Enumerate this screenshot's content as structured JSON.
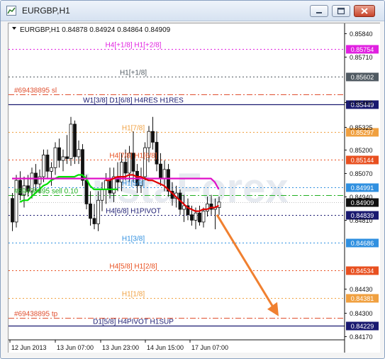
{
  "window": {
    "title": "EURGBP,H1"
  },
  "chart_header": "EURGBP,H1  0.84878 0.84924 0.84864 0.84909",
  "watermark": "InstaForex",
  "chart_data": {
    "type": "candlestick",
    "symbol": "EURGBP",
    "timeframe": "H1",
    "ohlc_header": {
      "open": 0.84878,
      "high": 0.84924,
      "low": 0.84864,
      "close": 0.84909
    },
    "ylim": [
      0.8415,
      0.8588
    ],
    "y_ticks": [
      0.8584,
      0.8571,
      0.8546,
      0.85325,
      0.852,
      0.8507,
      0.8494,
      0.8481,
      0.8443,
      0.843,
      0.8417
    ],
    "y_tick_labels": [
      "0.85840",
      "0.85710",
      "0.85460",
      "0.85325",
      "0.85200",
      "0.85070",
      "0.84940",
      "0.84810",
      "0.84430",
      "0.84300",
      "0.84170"
    ],
    "x_tick_labels": [
      "12 Jun 2013",
      "13 Jun 07:00",
      "13 Jun 23:00",
      "14 Jun 15:00",
      "17 Jun 07:00"
    ],
    "levels": [
      {
        "label": "H4[+1/8] H1[+2/8]",
        "price": 0.85754,
        "price_label": "0.85754",
        "color": "#e020e0",
        "style": "dotted"
      },
      {
        "label": "H1[+1/8]",
        "price": 0.85602,
        "price_label": "0.85602",
        "color": "#505a62",
        "style": "dotted"
      },
      {
        "label": "#69438895 sl",
        "price": 0.85505,
        "price_label": "",
        "color": "#e05030",
        "style": "dashdot"
      },
      {
        "label": "W1[3/8] D1[6/8] H4RES H1RES",
        "price": 0.85449,
        "price_label": "0.85449",
        "color": "#1a1a70",
        "style": "solid"
      },
      {
        "label": "H1[7/8]",
        "price": 0.85297,
        "price_label": "0.85297",
        "color": "#f0a040",
        "style": "dotted"
      },
      {
        "label": "H4[7/8] H1[6/8]",
        "price": 0.85144,
        "price_label": "0.85144",
        "color": "#e85020",
        "style": "dotted"
      },
      {
        "label": "H1[5/8]",
        "price": 0.84991,
        "price_label": "0.84991",
        "color": "#3090e0",
        "style": "dotted"
      },
      {
        "label": "#69438895 sell 0.10",
        "price": 0.8495,
        "price_label": "",
        "color": "#20b020",
        "style": "dashdot"
      },
      {
        "label": "H4[6/8] H1PIVOT",
        "price": 0.84839,
        "price_label": "0.84839",
        "color": "#1a1a70",
        "style": "dotted"
      },
      {
        "label": "H1[3/8]",
        "price": 0.84686,
        "price_label": "0.84686",
        "color": "#3090e0",
        "style": "dotted"
      },
      {
        "label": "H4[5/8] H1[2/8]",
        "price": 0.84534,
        "price_label": "0.84534",
        "color": "#e85020",
        "style": "dotted"
      },
      {
        "label": "H1[1/8]",
        "price": 0.84381,
        "price_label": "0.84381",
        "color": "#f0a040",
        "style": "dotted"
      },
      {
        "label": "#69438895 tp",
        "price": 0.8427,
        "price_label": "",
        "color": "#e05030",
        "style": "dashdot"
      },
      {
        "label": "D1[5/8] H4PIVOT H1SUP",
        "price": 0.84229,
        "price_label": "0.84229",
        "color": "#1a1a70",
        "style": "solid"
      }
    ],
    "current_price": {
      "price": 0.84909,
      "label": "0.84909"
    },
    "candles": [
      [
        0.8493,
        0.8496,
        0.8475,
        0.848
      ],
      [
        0.848,
        0.8506,
        0.8477,
        0.8503
      ],
      [
        0.8503,
        0.8508,
        0.8492,
        0.8495
      ],
      [
        0.8495,
        0.8505,
        0.8488,
        0.85
      ],
      [
        0.85,
        0.8506,
        0.8494,
        0.8497
      ],
      [
        0.8497,
        0.851,
        0.8493,
        0.8507
      ],
      [
        0.8507,
        0.8512,
        0.8497,
        0.8501
      ],
      [
        0.8501,
        0.8509,
        0.8496,
        0.8505
      ],
      [
        0.8505,
        0.852,
        0.8502,
        0.8517
      ],
      [
        0.8517,
        0.852,
        0.8504,
        0.8508
      ],
      [
        0.8508,
        0.8513,
        0.85,
        0.851
      ],
      [
        0.851,
        0.8524,
        0.8506,
        0.8521
      ],
      [
        0.8521,
        0.8526,
        0.851,
        0.8514
      ],
      [
        0.8514,
        0.852,
        0.8508,
        0.8516
      ],
      [
        0.8516,
        0.8528,
        0.8512,
        0.8515
      ],
      [
        0.8515,
        0.8538,
        0.8511,
        0.8534
      ],
      [
        0.8534,
        0.8536,
        0.8512,
        0.8516
      ],
      [
        0.8516,
        0.8525,
        0.8512,
        0.852
      ],
      [
        0.852,
        0.8523,
        0.85,
        0.8503
      ],
      [
        0.8503,
        0.8506,
        0.8487,
        0.849
      ],
      [
        0.849,
        0.8497,
        0.8478,
        0.8482
      ],
      [
        0.8482,
        0.849,
        0.8476,
        0.8479
      ],
      [
        0.8479,
        0.8497,
        0.8475,
        0.8492
      ],
      [
        0.8492,
        0.8502,
        0.8486,
        0.8498
      ],
      [
        0.8498,
        0.8507,
        0.849,
        0.8503
      ],
      [
        0.8503,
        0.851,
        0.8493,
        0.8496
      ],
      [
        0.8496,
        0.851,
        0.8491,
        0.8505
      ],
      [
        0.8505,
        0.8513,
        0.8497,
        0.8502
      ],
      [
        0.8502,
        0.8518,
        0.8497,
        0.8513
      ],
      [
        0.8513,
        0.852,
        0.8503,
        0.8507
      ],
      [
        0.8507,
        0.8522,
        0.8502,
        0.8518
      ],
      [
        0.8518,
        0.853,
        0.8502,
        0.8508
      ],
      [
        0.8508,
        0.8512,
        0.8496,
        0.85
      ],
      [
        0.85,
        0.851,
        0.8496,
        0.8505
      ],
      [
        0.8505,
        0.8524,
        0.8503,
        0.8521
      ],
      [
        0.8521,
        0.8533,
        0.8513,
        0.853
      ],
      [
        0.853,
        0.8538,
        0.852,
        0.8524
      ],
      [
        0.8524,
        0.853,
        0.8508,
        0.8512
      ],
      [
        0.8512,
        0.8518,
        0.85,
        0.8504
      ],
      [
        0.8504,
        0.8514,
        0.8497,
        0.8509
      ],
      [
        0.8509,
        0.8512,
        0.8494,
        0.8497
      ],
      [
        0.8497,
        0.8502,
        0.8489,
        0.8493
      ],
      [
        0.8493,
        0.85,
        0.8488,
        0.8496
      ],
      [
        0.8496,
        0.8498,
        0.8484,
        0.8487
      ],
      [
        0.8487,
        0.8495,
        0.848,
        0.8489
      ],
      [
        0.8489,
        0.8493,
        0.8481,
        0.8484
      ],
      [
        0.8484,
        0.8489,
        0.8478,
        0.8481
      ],
      [
        0.8481,
        0.8488,
        0.8476,
        0.8485
      ],
      [
        0.8485,
        0.8489,
        0.8478,
        0.848
      ],
      [
        0.848,
        0.8488,
        0.8477,
        0.8486
      ],
      [
        0.8486,
        0.8494,
        0.8483,
        0.849
      ],
      [
        0.849,
        0.8495,
        0.8484,
        0.8487
      ],
      [
        0.8487,
        0.8493,
        0.8476,
        0.8488
      ],
      [
        0.8488,
        0.8494,
        0.8484,
        0.8491
      ]
    ],
    "moving_averages": [
      {
        "name": "",
        "color": "#00e000",
        "from_index": 2,
        "values": [
          0.8491,
          0.8492,
          0.8492,
          0.8494,
          0.8496,
          0.8498,
          0.85,
          0.8501,
          0.8503,
          0.8504,
          0.8505,
          0.8505,
          0.8505,
          0.8505,
          0.8505,
          0.8506,
          0.8506,
          0.8504,
          0.85,
          0.8498,
          0.8498,
          0.8498,
          0.8498,
          0.8498,
          0.8498,
          0.8498
        ]
      },
      {
        "name": "",
        "color": "#e010c8",
        "from_index": 0,
        "values": [
          0.8504,
          0.8504,
          0.8504,
          0.8504,
          0.8504,
          0.8504,
          0.8504,
          0.8504,
          0.8504,
          0.8504,
          0.8504,
          0.8504,
          0.8504,
          0.8504,
          0.8504,
          0.8504,
          0.8504,
          0.8504,
          0.8504,
          0.8504,
          0.8504,
          0.8504,
          0.8504,
          0.8504,
          0.8504,
          0.8504,
          0.8504,
          0.8504,
          0.8504,
          0.8504,
          0.8504,
          0.8504,
          0.8504,
          0.8504,
          0.8504,
          0.8504,
          0.8504,
          0.8504,
          0.8504,
          0.8504,
          0.8504,
          0.8504,
          0.8504,
          0.8504,
          0.8504,
          0.8504,
          0.8504,
          0.8504,
          0.8504,
          0.8504,
          0.8504,
          0.8504,
          0.8502,
          0.8498
        ]
      },
      {
        "name": "",
        "color": "#e00000",
        "from_index": 24,
        "values": [
          0.8503,
          0.8503,
          0.8504,
          0.8505,
          0.8505,
          0.8505,
          0.8506,
          0.8506,
          0.8505,
          0.8505,
          0.8504,
          0.8503,
          0.8503,
          0.8502,
          0.8501,
          0.85,
          0.8498,
          0.8496,
          0.8494,
          0.8492,
          0.849,
          0.8488,
          0.8487,
          0.8486,
          0.8486,
          0.8487,
          0.8487,
          0.8488,
          0.8488,
          0.8489
        ]
      }
    ],
    "arrow": {
      "color": "#f08030",
      "direction": "down",
      "from": [
        0.8484
      ],
      "to": [
        0.8428
      ]
    },
    "grid": false,
    "legend": "none"
  }
}
